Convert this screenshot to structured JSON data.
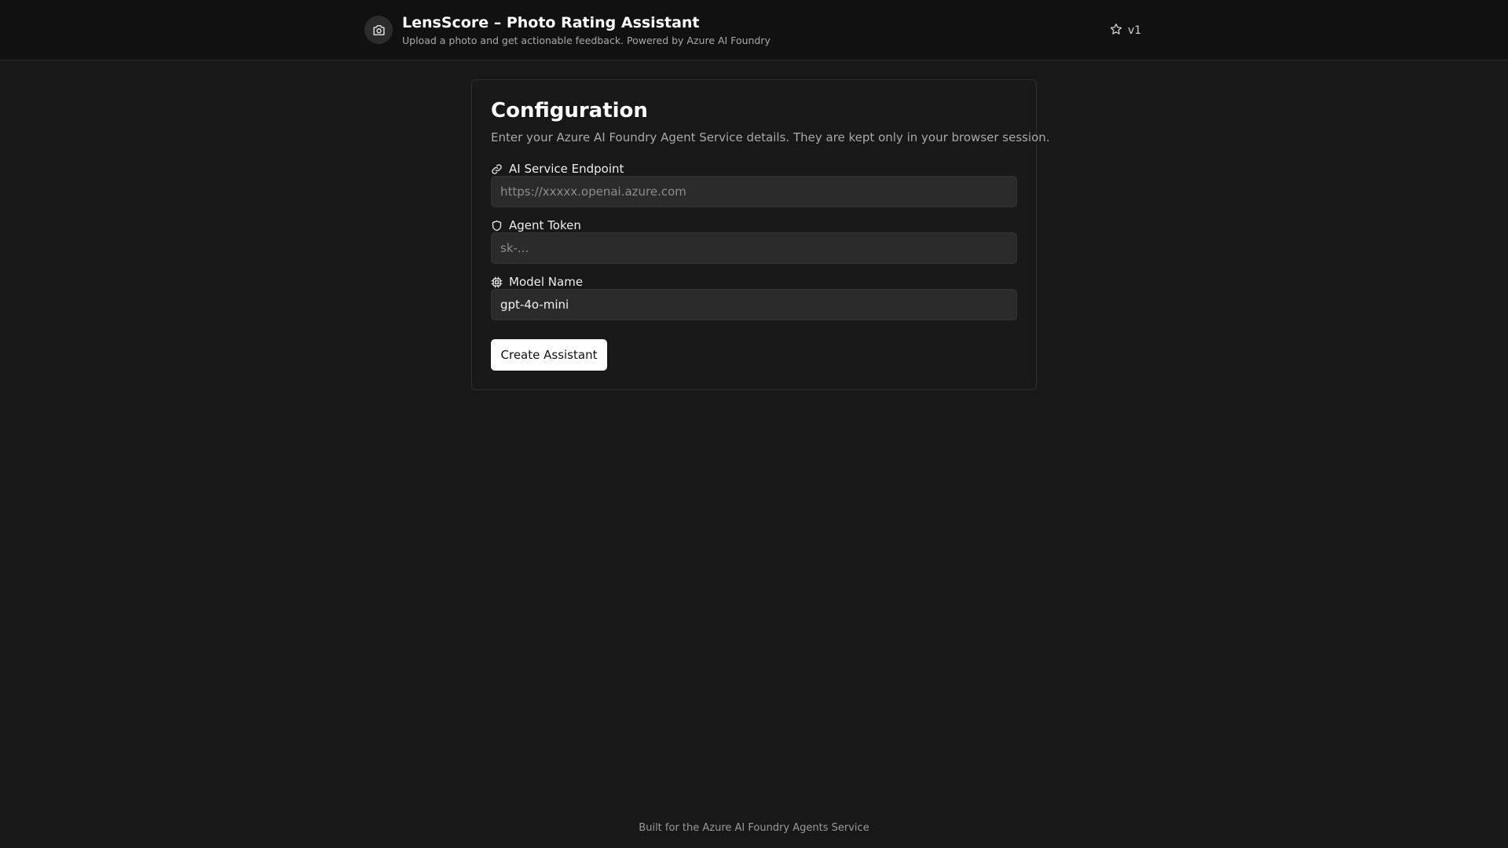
{
  "header": {
    "title": "LensScore – Photo Rating Assistant",
    "subtitle": "Upload a photo and get actionable feedback. Powered by Azure AI Foundry",
    "brand_icon": "camera-icon",
    "version_icon": "star-icon",
    "version": "v1"
  },
  "config": {
    "title": "Configuration",
    "description": "Enter your Azure AI Foundry Agent Service details. They are kept only in your browser session.",
    "fields": [
      {
        "label": "AI Service Endpoint",
        "icon": "link-icon",
        "value": "",
        "placeholder": "https://xxxxx.openai.azure.com"
      },
      {
        "label": "Agent Token",
        "icon": "shield-icon",
        "value": "",
        "placeholder": "sk-..."
      },
      {
        "label": "Model Name",
        "icon": "cpu-icon",
        "value": "gpt-4o-mini",
        "placeholder": ""
      }
    ],
    "submit_label": "Create Assistant"
  },
  "footer": {
    "text": "Built for the Azure AI Foundry Agents Service"
  },
  "colors": {
    "background": "#181818",
    "header": "#111111",
    "input": "#2b2b2b",
    "button": "#ffffff"
  }
}
